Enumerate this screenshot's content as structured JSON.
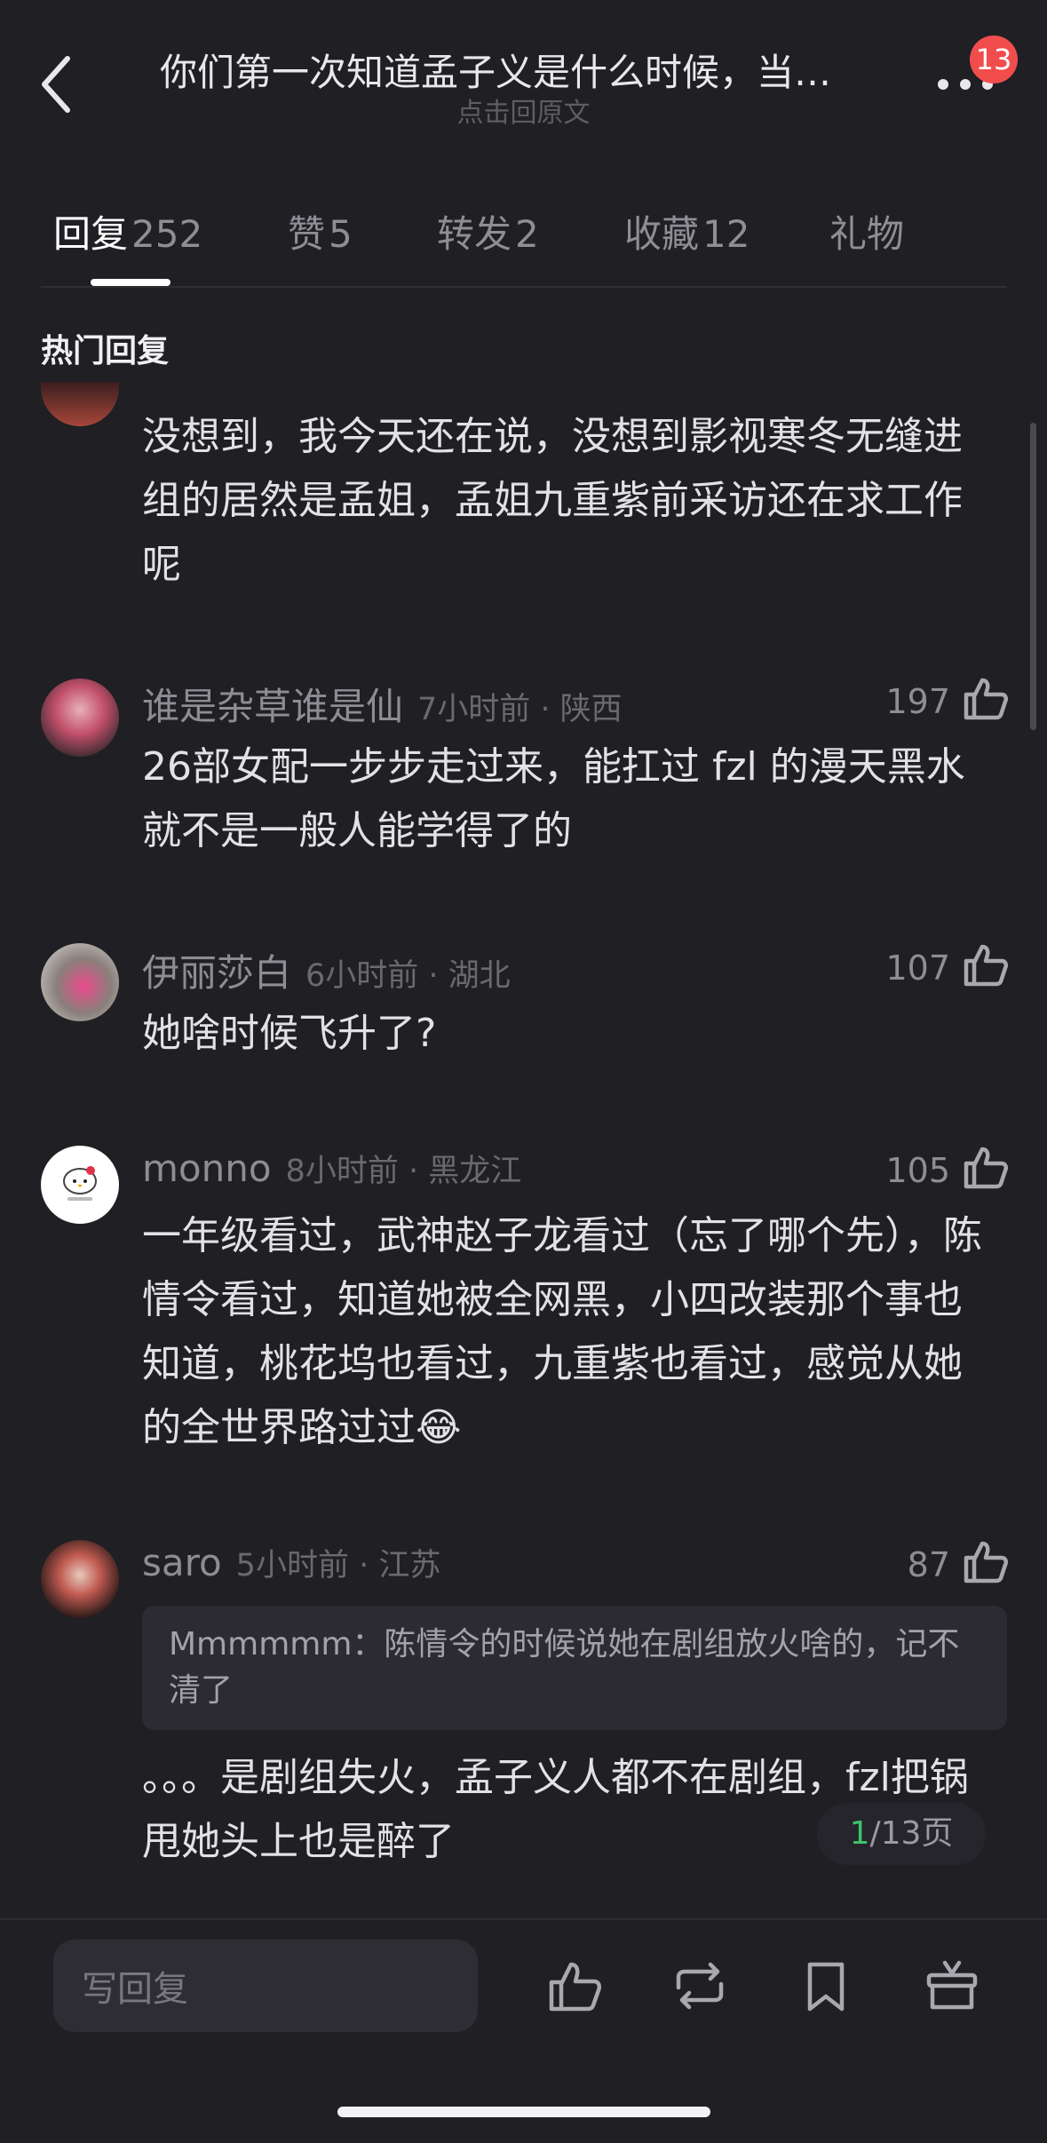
{
  "header": {
    "title": "你们第一次知道孟子义是什么时候，当…",
    "subtitle": "点击回原文",
    "badge_count": "13"
  },
  "tabs": [
    {
      "label": "回复",
      "count": "252"
    },
    {
      "label": "赞",
      "count": "5"
    },
    {
      "label": "转发",
      "count": "2"
    },
    {
      "label": "收藏",
      "count": "12"
    },
    {
      "label": "礼物",
      "count": ""
    }
  ],
  "section_title": "热门回复",
  "comments": [
    {
      "text": "没想到，我今天还在说，没想到影视寒冬无缝进组的居然是孟姐，孟姐九重紫前采访还在求工作呢"
    },
    {
      "name": "谁是杂草谁是仙",
      "meta": "7小时前 · 陕西",
      "likes": "197",
      "text": "26部女配一步步走过来，能扛过 fzl 的漫天黑水就不是一般人能学得了的"
    },
    {
      "name": "伊丽莎白",
      "meta": "6小时前 · 湖北",
      "likes": "107",
      "text": "她啥时候飞升了?"
    },
    {
      "name": "monno",
      "meta": "8小时前 · 黑龙江",
      "likes": "105",
      "text": "一年级看过，武神赵子龙看过（忘了哪个先），陈情令看过，知道她被全网黑，小四改装那个事也知道，桃花坞也看过，九重紫也看过，感觉从她的全世界路过过😂"
    },
    {
      "name": "saro",
      "meta": "5小时前 · 江苏",
      "likes": "87",
      "quote": "Mmmmmm：陈情令的时候说她在剧组放火啥的，记不清了",
      "text": "。。。是剧组失火，孟子义人都不在剧组，fzl把锅甩她头上也是醉了"
    }
  ],
  "page_indicator": {
    "current": "1",
    "total": "/13页"
  },
  "bottom_bar": {
    "reply_placeholder": "写回复"
  },
  "colors": {
    "background": "#1f1f24",
    "badge": "#f24d4d",
    "page_current": "#3fc06a"
  },
  "icons": [
    "back-icon",
    "more-icon",
    "thumbs-up-icon",
    "repost-icon",
    "bookmark-icon",
    "gift-icon"
  ]
}
